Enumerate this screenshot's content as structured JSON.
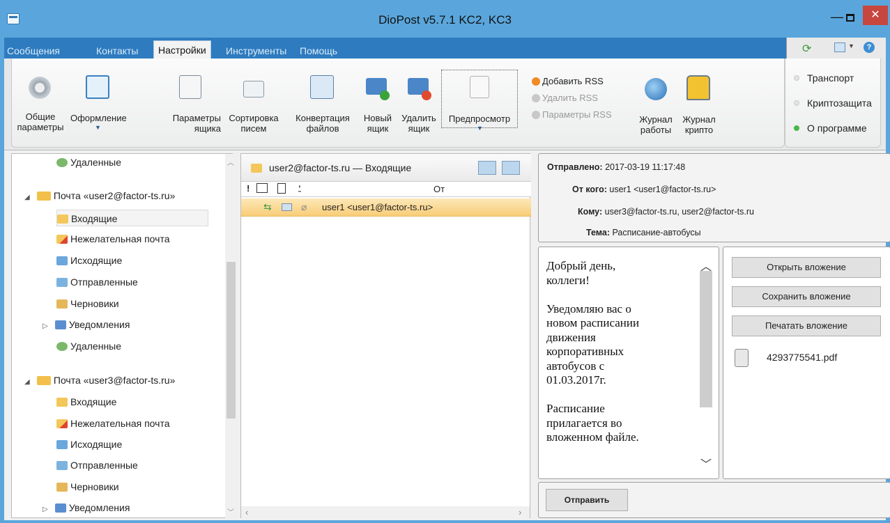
{
  "window": {
    "title": "DioPost v5.7.1 KC2, KC3",
    "minimize": "—",
    "close": "✕"
  },
  "menu": {
    "tabs": [
      "Сообщения",
      "Контакты",
      "Настройки",
      "Инструменты",
      "Помощь"
    ],
    "active": "Настройки"
  },
  "ribbon": {
    "buttons": [
      {
        "label": "Общие\nпараметры"
      },
      {
        "label": "Оформление"
      },
      {
        "label": "Параметры\nящика"
      },
      {
        "label": "Сортировка\nписем"
      },
      {
        "label": "Конвертация\nфайлов"
      },
      {
        "label": "Новый\nящик"
      },
      {
        "label": "Удалить\nящик"
      },
      {
        "label": "Предпросмотр"
      }
    ],
    "rss": [
      "Добавить RSS",
      "Удалить RSS",
      "Параметры RSS"
    ],
    "journals": [
      "Журнал\nработы",
      "Журнал\nкрипто"
    ],
    "side": [
      "Транспорт",
      "Криптозащита",
      "О программе"
    ]
  },
  "tree": {
    "top_deleted": "Удаленные",
    "account2": "Почта «user2@factor-ts.ru»",
    "account3": "Почта «user3@factor-ts.ru»",
    "folders": [
      "Входящие",
      "Нежелательная почта",
      "Исходящие",
      "Отправленные",
      "Черновики",
      "Уведомления",
      "Удаленные"
    ],
    "folders3": [
      "Входящие",
      "Нежелательная почта",
      "Исходящие",
      "Отправленные",
      "Черновики",
      "Уведомления"
    ]
  },
  "messages": {
    "header": "user2@factor-ts.ru — Входящие",
    "columns": {
      "flag": "!",
      "from": "От"
    },
    "row_from": "user1 <user1@factor-ts.ru>"
  },
  "props": {
    "sent_label": "Отправлено:",
    "sent": "2017-03-19 11:17:48",
    "from_label": "От кого:",
    "from": "user1 <user1@factor-ts.ru>",
    "to_label": "Кому:",
    "to": "user3@factor-ts.ru, user2@factor-ts.ru",
    "subject_label": "Тема:",
    "subject": "Расписание-автобусы"
  },
  "body": {
    "text": "Добрый день,\nколлеги!\n\nУведомляю вас о\nновом расписании\nдвижения\nкорпоративных\nавтобусов с\n01.03.2017г.\n\nРасписание\nприлагается во\nвложенном файле."
  },
  "attachments": {
    "open": "Открыть вложение",
    "save": "Сохранить вложение",
    "print": "Печатать вложение",
    "file": "4293775541.pdf"
  },
  "send": {
    "label": "Отправить"
  },
  "colors": {
    "titlebar": "#5aa6dc",
    "menubar": "#2e7bbf",
    "selected_row": "#f8cd78",
    "close": "#c7463f"
  }
}
